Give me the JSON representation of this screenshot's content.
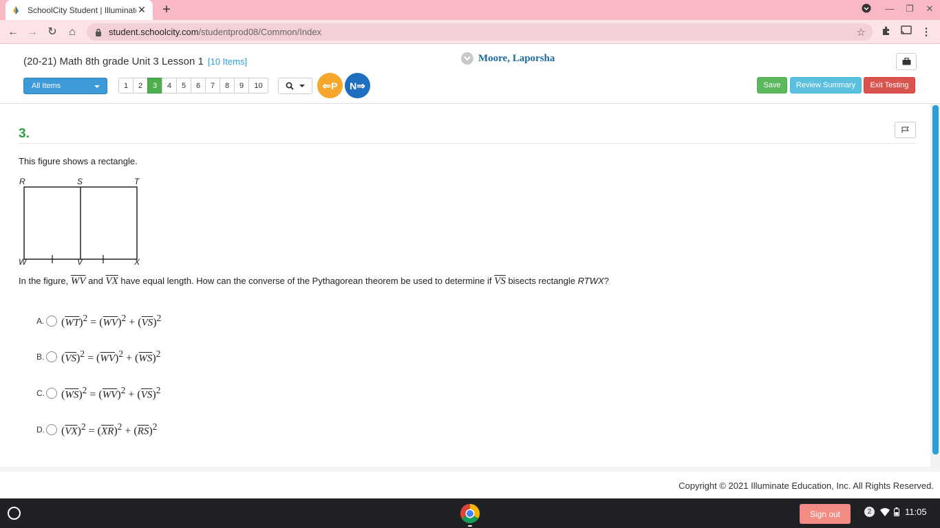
{
  "browser": {
    "tab_title": "SchoolCity Student | Illuminate E",
    "url_host": "student.schoolcity.com",
    "url_path": "/studentprod08/Common/Index"
  },
  "header": {
    "test_title": "(20-21) Math 8th grade Unit 3 Lesson 1",
    "items_count": "[10 Items]",
    "student_name": "Moore, Laporsha",
    "filter_label": "All Items",
    "pages": [
      "1",
      "2",
      "3",
      "4",
      "5",
      "6",
      "7",
      "8",
      "9",
      "10"
    ],
    "active_page": "3",
    "prev_label": "P",
    "next_label": "N",
    "save_label": "Save",
    "review_label": "Review Summary",
    "exit_label": "Exit Testing"
  },
  "question": {
    "number": "3.",
    "stem_intro": "This figure shows a rectangle.",
    "figure_labels": {
      "R": "R",
      "S": "S",
      "T": "T",
      "W": "W",
      "V": "V",
      "X": "X"
    },
    "stem": {
      "p1": "In the figure, ",
      "seg1": "WV",
      "p2": " and ",
      "seg2": "VX",
      "p3": " have equal length. How can the converse of the Pythagorean theorem be used to determine if ",
      "seg3": "VS",
      "p4": " bisects rectangle ",
      "rect": "RTWX",
      "p5": "?"
    },
    "choices": [
      {
        "letter": "A.",
        "a": "WT",
        "b": "WV",
        "c": "VS"
      },
      {
        "letter": "B.",
        "a": "VS",
        "b": "WV",
        "c": "WS"
      },
      {
        "letter": "C.",
        "a": "WS",
        "b": "WV",
        "c": "VS"
      },
      {
        "letter": "D.",
        "a": "VX",
        "b": "XR",
        "c": "RS"
      }
    ],
    "exponent": "2"
  },
  "footer": {
    "copyright": "Copyright © 2021 Illuminate Education, Inc. All Rights Reserved."
  },
  "shelf": {
    "sign_out": "Sign out",
    "notification_count": "2",
    "time": "11:05"
  },
  "colors": {
    "tab_strip": "#f9b8c6",
    "question_number": "#2e9b44",
    "active_page": "#4cae4c",
    "prev": "#f6a62b",
    "next": "#1f6fc0"
  }
}
